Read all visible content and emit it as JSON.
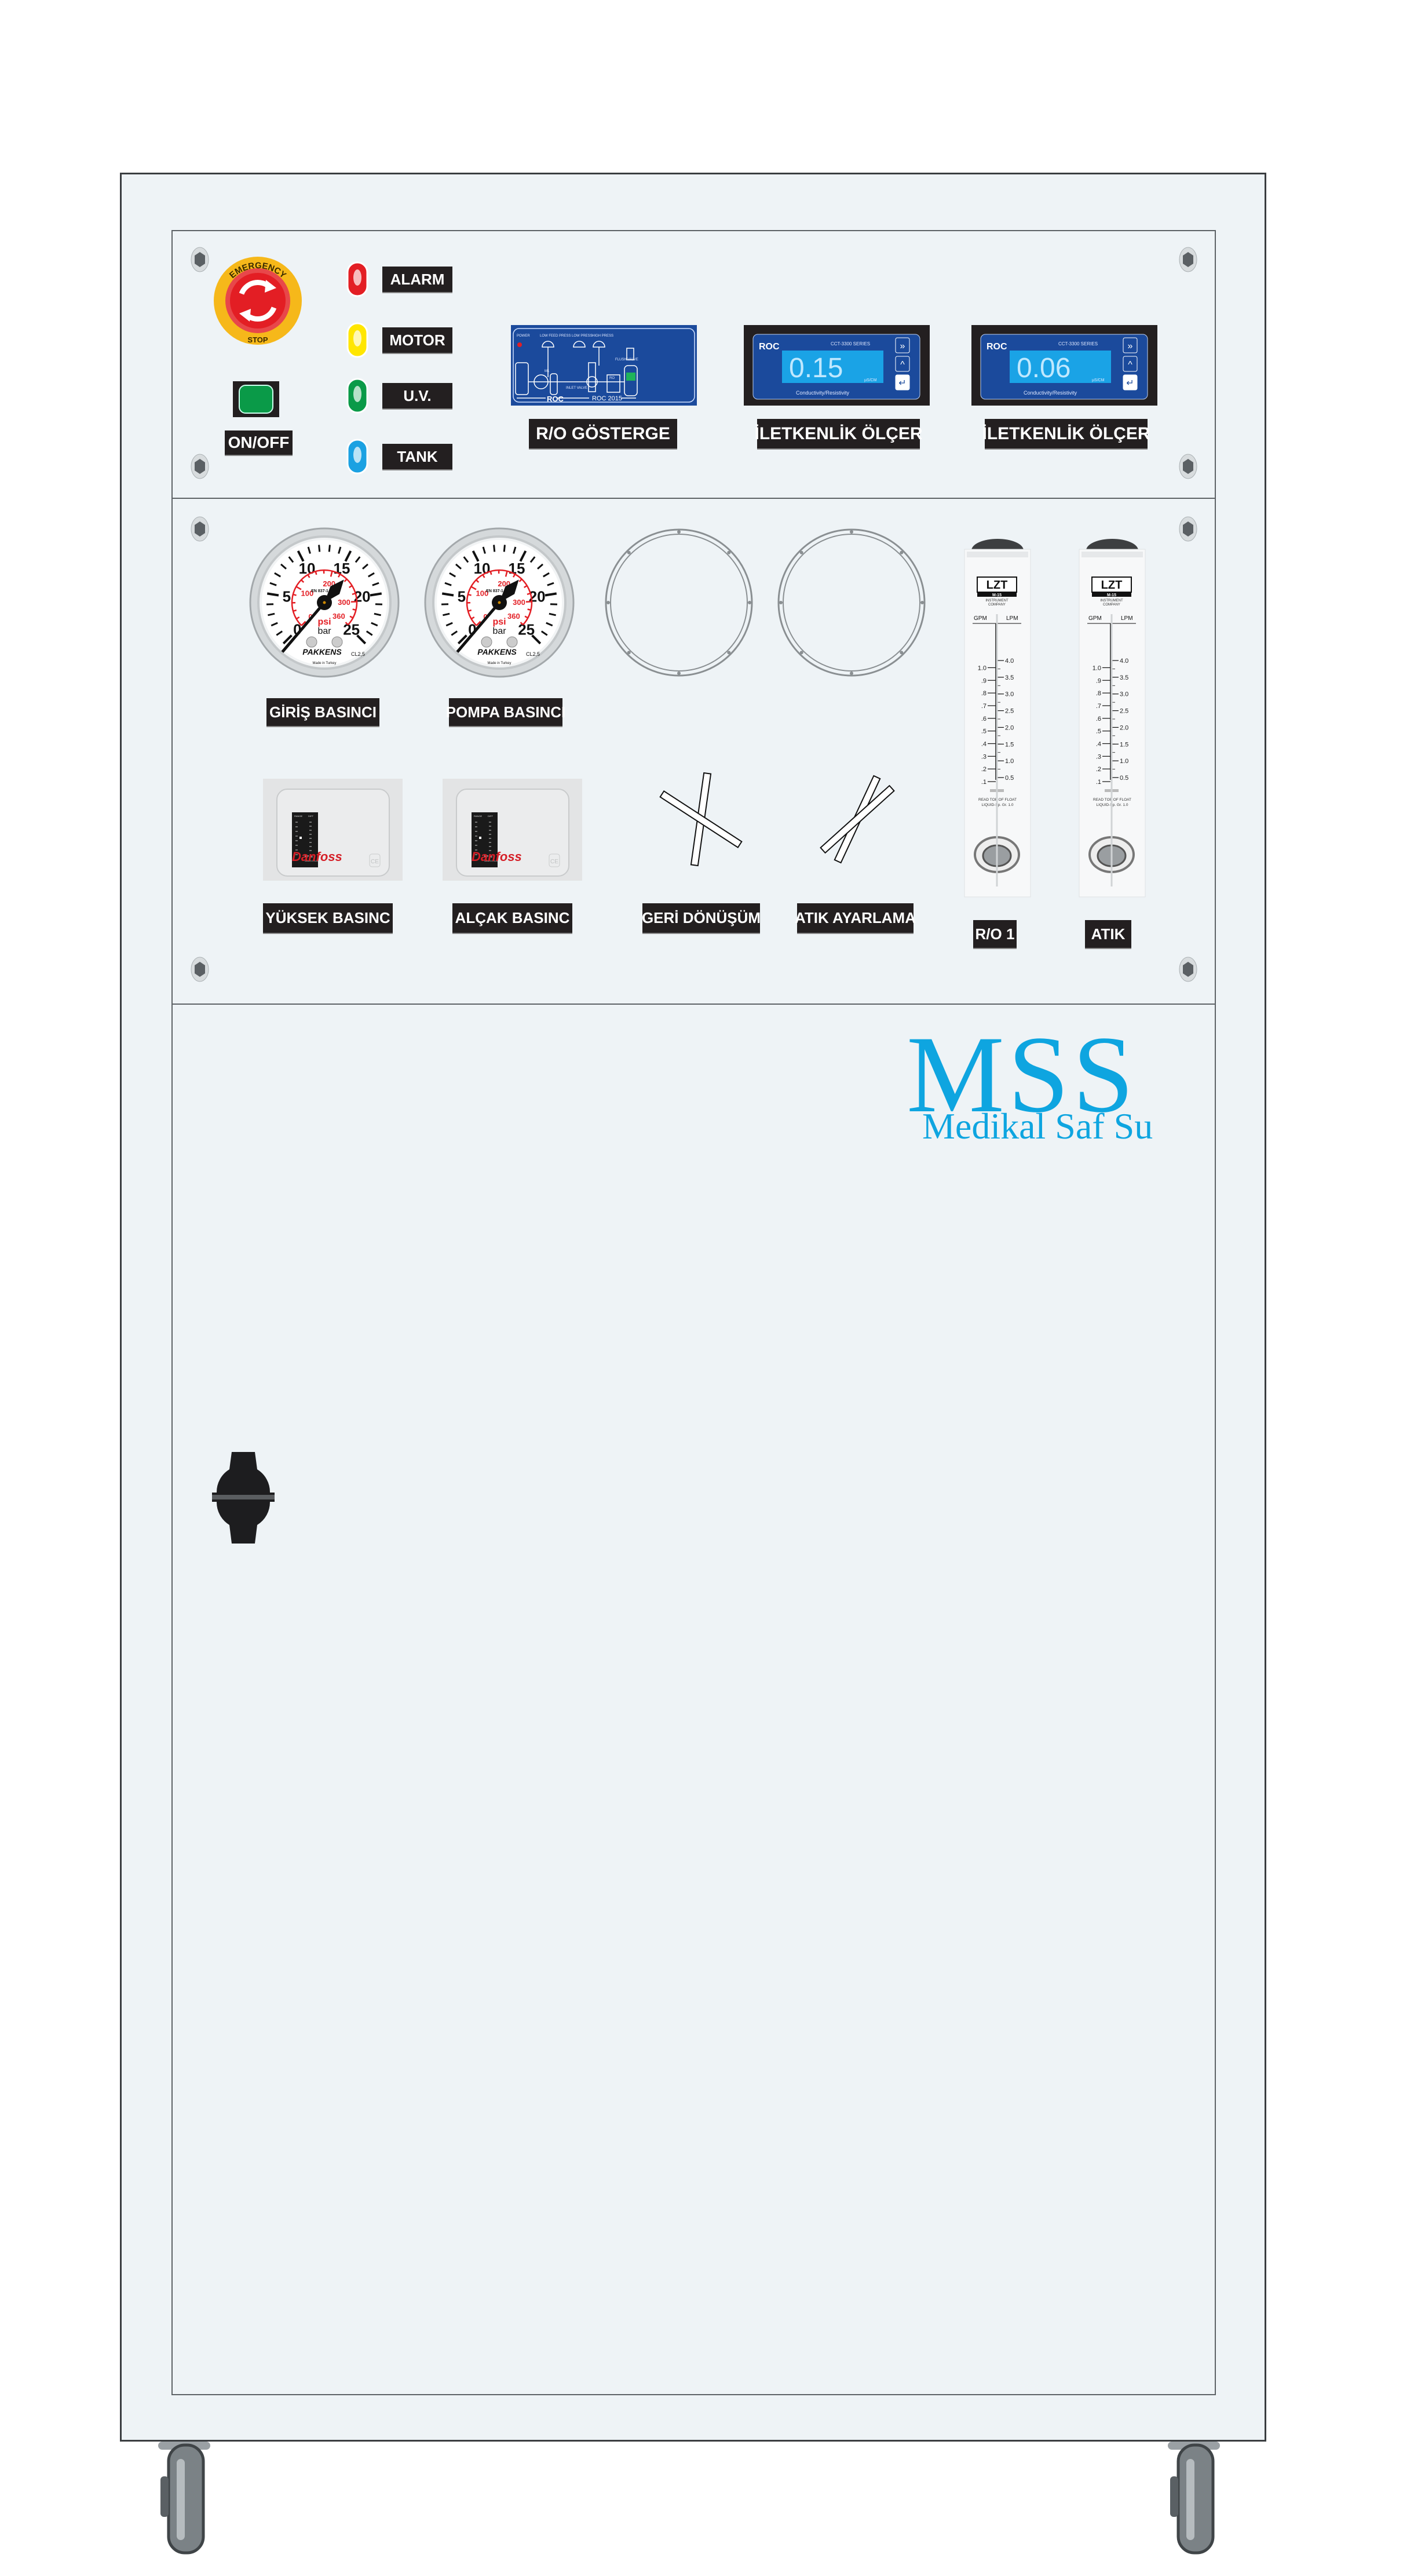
{
  "emergency_stop": {
    "top_text": "EMERGENCY",
    "bottom_text": "STOP",
    "ring_color": "#f6b81a",
    "button_color": "#e31e24"
  },
  "power": {
    "label": "ON/OFF",
    "color": "#0a9a48"
  },
  "indicators": [
    {
      "label": "ALARM",
      "color": "#e31e24"
    },
    {
      "label": "MOTOR",
      "color": "#ffe600"
    },
    {
      "label": "U.V.",
      "color": "#0a9a48"
    },
    {
      "label": "TANK",
      "color": "#1ba1e2"
    }
  ],
  "ro_display": {
    "label": "R/O GÖSTERGE",
    "brand": "ROC",
    "model": "ROC 2015",
    "power": "POWER",
    "low_feed": "LOW FEED PRESS",
    "low_press": "LOW PRESS",
    "high_press": "HIGH PRESS",
    "flush": "FLUSH VALVE",
    "inlet": "INLET VALVE",
    "ro": "RO",
    "m1": "M1",
    "color": "#1b4a9c"
  },
  "meters": [
    {
      "label": "İLETKENLİK ÖLÇER",
      "brand": "ROC",
      "series": "CCT-3300 SERIES",
      "value": "0.15",
      "unit": "µS/CM",
      "caption": "Conductivity/Resistivity"
    },
    {
      "label": "İLETKENLİK ÖLÇER",
      "brand": "ROC",
      "series": "CCT-3300 SERIES",
      "value": "0.06",
      "unit": "µS/CM",
      "caption": "Conductivity/Resistivity"
    }
  ],
  "gauge_face": {
    "bar_ticks": [
      0,
      5,
      10,
      15,
      20,
      25
    ],
    "bar_max": 25,
    "psi_ticks": [
      0,
      100,
      200,
      300,
      360
    ],
    "unit_bar": "bar",
    "unit_psi": "psi",
    "brand": "PAKKENS",
    "standard": "EN 837-1",
    "class": "CL2,5",
    "origin": "Made in Turkey"
  },
  "gauges": [
    {
      "label": "GİRİŞ BASINCI",
      "reading_bar": 0
    },
    {
      "label": "POMPA BASINCI",
      "reading_bar": 0
    }
  ],
  "empty_gauge_slots": 2,
  "switch_face": {
    "brand": "Danfoss",
    "range": "RANGE",
    "diff": "DIFF",
    "model": "KP 36",
    "made": "MADE IN POLAND",
    "mark": "CE"
  },
  "pressure_switches": [
    {
      "label": "YÜKSEK BASINC"
    },
    {
      "label": "ALÇAK BASINC"
    }
  ],
  "valves": [
    {
      "label": "GERİ DÖNÜŞÜM"
    },
    {
      "label": "ATIK AYARLAMA"
    }
  ],
  "flowmeter_face": {
    "brand": "LZT",
    "model": "M-15",
    "maker_line1": "INSTRUMENT",
    "maker_line2": "COMPANY",
    "left_unit": "GPM",
    "right_unit": "LPM",
    "gpm_ticks": [
      ".1",
      ".2",
      ".3",
      ".4",
      ".5",
      ".6",
      ".7",
      ".8",
      ".9",
      "1.0"
    ],
    "lpm_ticks": [
      "0.5",
      "1.0",
      "1.5",
      "2.0",
      "2.5",
      "3.0",
      "3.5",
      "4.0"
    ],
    "note1": "READ TOP OF FLOAT",
    "note2": "LIQUID-Sp. Gr. 1.0"
  },
  "flowmeters": [
    {
      "label": "R/O 1"
    },
    {
      "label": "ATIK"
    }
  ],
  "logo": {
    "name": "MSS",
    "subtitle": "Medikal Saf Su",
    "color": "#0ea5e0"
  }
}
